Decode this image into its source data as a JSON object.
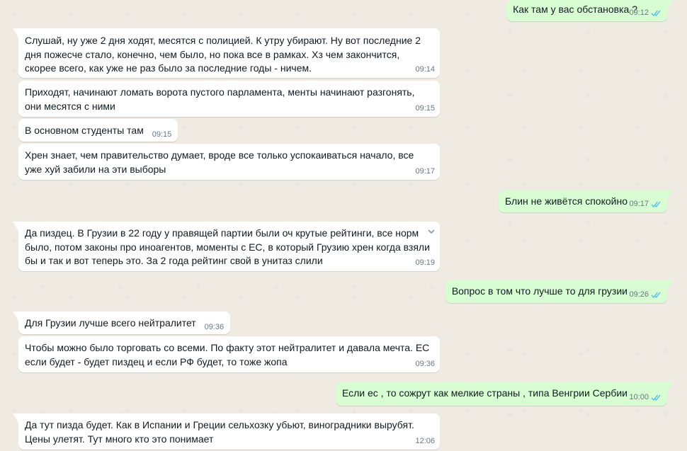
{
  "messages": [
    {
      "text": "Как там у вас обстановка ?",
      "time": "09:12",
      "direction": "out",
      "status": "read"
    },
    {
      "text": "Слушай, ну уже 2 дня ходят, месятся с полицией. К утру убирают. Ну вот последние 2 дня пожесче стало, конечно, чем было, но пока все в рамках. Хз чем закончится, скорее всего, как уже не раз было за последние годы - ничем.",
      "time": "09:14",
      "direction": "in"
    },
    {
      "text": "Приходят, начинают ломать ворота пустого парламента, менты начинают разгонять, они месятся с ними",
      "time": "09:15",
      "direction": "in"
    },
    {
      "text": "В основном студенты там",
      "time": "09:15",
      "direction": "in"
    },
    {
      "text": "Хрен знает, чем правительство думает, вроде все только успокаиваться начало, все уже хуй забили на эти выборы",
      "time": "09:17",
      "direction": "in"
    },
    {
      "text": "Блин не живётся спокойно",
      "time": "09:17",
      "direction": "out",
      "status": "read"
    },
    {
      "text": "Да пиздец. В Грузии в 22 году у правящей партии были оч крутые рейтинги, все норм было, потом законы про иноагентов, моменты с ЕС, в который Грузию хрен когда взяли бы и так и вот теперь это. За 2 года рейтинг свой в унитаз слили",
      "time": "09:19",
      "direction": "in"
    },
    {
      "text": "Вопрос в том что лучше то для грузии",
      "time": "09:26",
      "direction": "out",
      "status": "read"
    },
    {
      "text": "Для Грузии лучше всего нейтралитет",
      "time": "09:36",
      "direction": "in"
    },
    {
      "text": "Чтобы можно было торговать со всеми. По факту этот нейтралитет и давала мечта. ЕС если будет - будет пиздец и если РФ будет, то тоже жопа",
      "time": "09:36",
      "direction": "in"
    },
    {
      "text": "Если ес , то сожрут как  мелкие страны , типа Венгрии Сербии",
      "time": "10:00",
      "direction": "out",
      "status": "read"
    },
    {
      "text": "Да тут пизда будет. Как в Испании и Греции сельхозку убьют, виноградники вырубят. Цены улетят. Тут много кто это понимает",
      "time": "12:06",
      "direction": "in"
    }
  ],
  "colors": {
    "background": "#efeae2",
    "incoming_bubble": "#ffffff",
    "outgoing_bubble": "#d9fdd3",
    "read_ticks": "#53bdeb",
    "text": "#111b21",
    "meta": "#667781"
  }
}
